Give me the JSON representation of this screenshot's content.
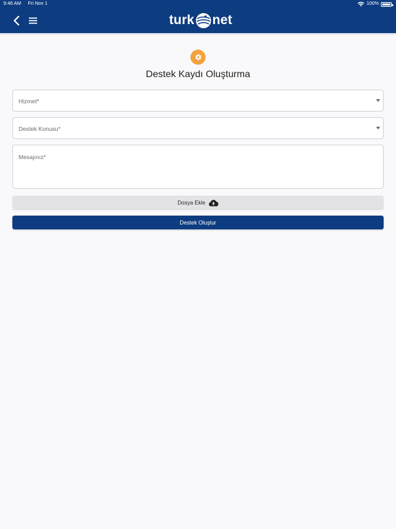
{
  "status_bar": {
    "time": "9:46 AM",
    "date": "Fri Nov 1",
    "battery": "100%",
    "wifi_icon": "wifi-icon",
    "battery_icon": "battery-icon"
  },
  "nav": {
    "back_icon": "chevron-left-icon",
    "menu_icon": "hamburger-menu-icon",
    "logo_left": "turk",
    "logo_right": "net"
  },
  "colors": {
    "brand": "#0d3c80",
    "accent": "#f4a23c",
    "background": "#f9f9fb"
  },
  "page": {
    "icon": "gear-icon",
    "title": "Destek Kaydı Oluşturma"
  },
  "form": {
    "service_label": "Hizmet*",
    "subject_label": "Destek Konusu*",
    "message_label": "Mesajınız*",
    "attach_label": "Dosya Ekle",
    "attach_icon": "cloud-upload-icon",
    "submit_label": "Destek Oluştur"
  }
}
